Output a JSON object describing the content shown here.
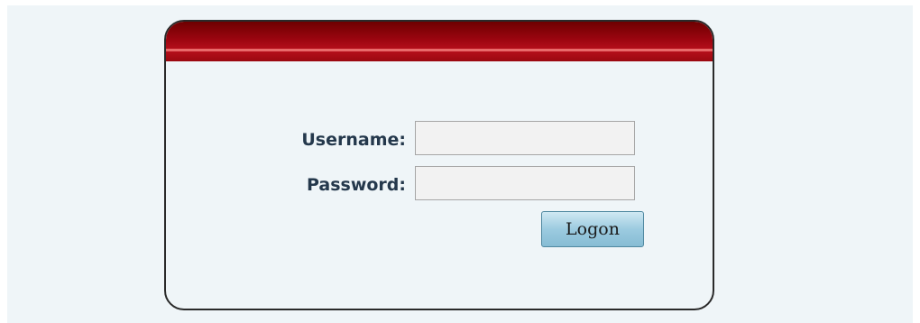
{
  "login": {
    "username_label": "Username:",
    "username_value": "",
    "password_label": "Password:",
    "password_value": "",
    "logon_label": "Logon"
  },
  "colors": {
    "header": "#9c0510",
    "background": "#eff5f8",
    "label": "#24384c",
    "button": "#9ccbe0"
  }
}
